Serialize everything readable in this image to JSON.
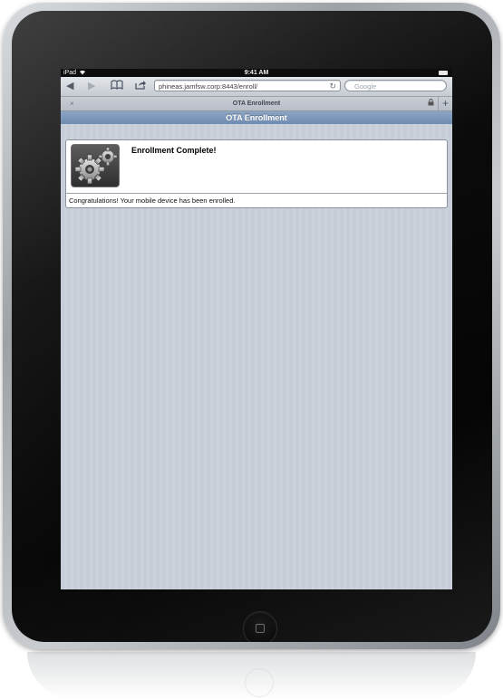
{
  "status_bar": {
    "carrier": "iPad",
    "time": "9:41 AM"
  },
  "toolbar": {
    "url": "phineas.jamfsw.corp:8443/enroll/",
    "search_placeholder": "Google"
  },
  "tab_bar": {
    "tab_title": "OTA Enrollment",
    "close_symbol": "×",
    "new_tab_symbol": "+"
  },
  "page": {
    "header_title": "OTA Enrollment",
    "card": {
      "title": "Enrollment Complete!",
      "message": "Congratulations! Your mobile device has been enrolled.",
      "icon": "settings-gears-icon"
    }
  },
  "colors": {
    "page_background": "#c6cdd7",
    "header_blue": "#7c96b9",
    "bezel": "#0b0b0b"
  }
}
